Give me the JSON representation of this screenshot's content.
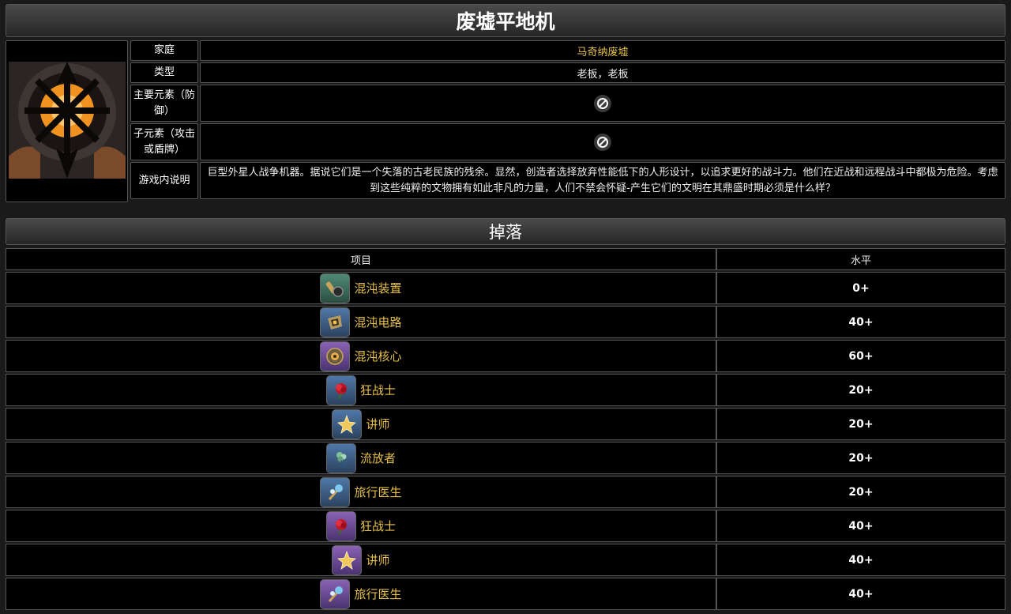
{
  "title": "废墟平地机",
  "info": {
    "family_label": "家庭",
    "family_value": "马奇纳废墟",
    "type_label": "类型",
    "type_value": "老板，老板",
    "main_element_label": "主要元素（防御）",
    "sub_element_label": "子元素（攻击或盾牌）",
    "description_label": "游戏内说明",
    "description_value": "巨型外星人战争机器。据说它们是一个失落的古老民族的残余。显然，创造者选择放弃性能低下的人形设计，以追求更好的战斗力。他们在近战和远程战斗中都极为危险。考虑到这些纯粹的文物拥有如此非凡的力量，人们不禁会怀疑-产生它们的文明在其鼎盛时期必须是什么样？"
  },
  "drops": {
    "heading": "掉落",
    "col_item": "项目",
    "col_level": "水平",
    "rows": [
      {
        "name": "混沌装置",
        "level": "0+",
        "icon": "chaos-device-icon",
        "quality": "q2"
      },
      {
        "name": "混沌电路",
        "level": "40+",
        "icon": "chaos-circuit-icon",
        "quality": "q3"
      },
      {
        "name": "混沌核心",
        "level": "60+",
        "icon": "chaos-core-icon",
        "quality": "q4"
      },
      {
        "name": "狂战士",
        "level": "20+",
        "icon": "berserker-flower-icon",
        "quality": "q3"
      },
      {
        "name": "讲师",
        "level": "20+",
        "icon": "instructor-flower-icon",
        "quality": "q3"
      },
      {
        "name": "流放者",
        "level": "20+",
        "icon": "exile-flower-icon",
        "quality": "q3"
      },
      {
        "name": "旅行医生",
        "level": "20+",
        "icon": "traveling-doctor-flower-icon",
        "quality": "q3"
      },
      {
        "name": "狂战士",
        "level": "40+",
        "icon": "berserker-flower-icon",
        "quality": "q4"
      },
      {
        "name": "讲师",
        "level": "40+",
        "icon": "instructor-flower-icon",
        "quality": "q4"
      },
      {
        "name": "旅行医生",
        "level": "40+",
        "icon": "traveling-doctor-flower-icon",
        "quality": "q4"
      }
    ]
  },
  "colors": {
    "accent_gold": "#e7c048",
    "background": "#000000",
    "border": "#555555"
  }
}
